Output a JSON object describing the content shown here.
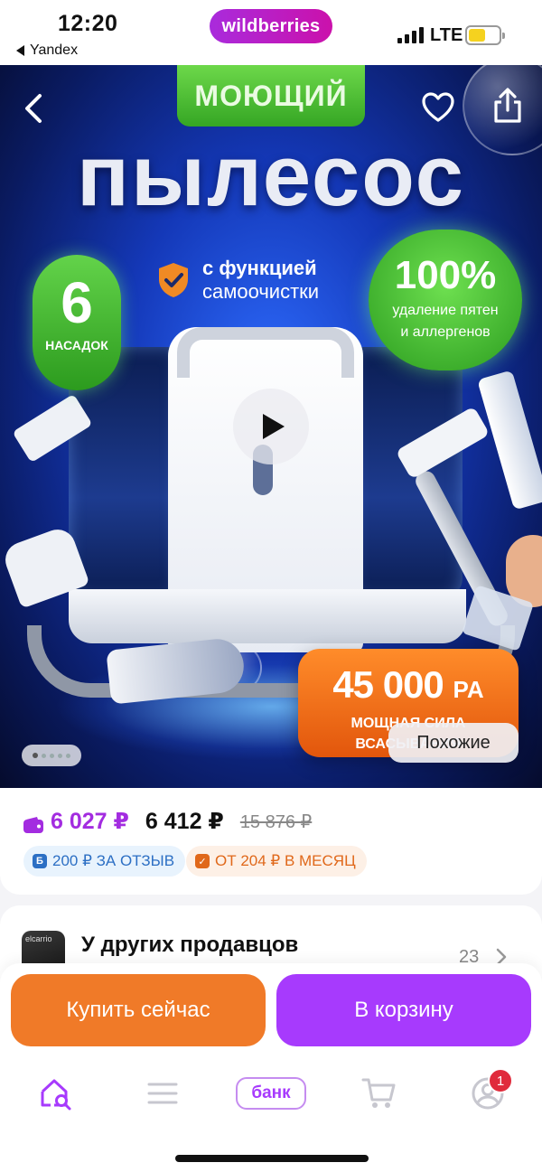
{
  "status_bar": {
    "time": "12:20",
    "back_app": "Yandex",
    "brand": "wildberries",
    "network": "LTE"
  },
  "hero": {
    "tag": "МОЮЩИЙ",
    "title": "пылесос",
    "badge_left_number": "6",
    "badge_left_caption": "НАСАДОК",
    "feature_line1": "с функцией",
    "feature_line2": "самоочистки",
    "badge_right_number": "100%",
    "badge_right_caption_line1": "удаление пятен",
    "badge_right_caption_line2": "и аллергенов",
    "power_number": "45 000",
    "power_unit": "PA",
    "power_caption_line1": "МОЩНАЯ СИЛА",
    "power_caption_line2": "ВСАСЫВАНИЯ",
    "similar_label": "Похожие",
    "slide_count": 5,
    "active_slide": 1
  },
  "price": {
    "wallet_price": "6 027 ₽",
    "price": "6 412 ₽",
    "old_price": "15 876 ₽",
    "chip_review_icon": "Б",
    "chip_review": "200 ₽ ЗА ОТЗЫВ",
    "chip_month_icon": "✓",
    "chip_month": "ОТ 204 ₽ В МЕСЯЦ"
  },
  "sellers": {
    "title": "У других продавцов",
    "count": "23",
    "thumb_text": "elcarrio"
  },
  "actions": {
    "buy_now": "Купить сейчас",
    "add_to_cart": "В корзину"
  },
  "tabbar": {
    "bank": "банк",
    "notifications": "1"
  },
  "colors": {
    "brand_purple": "#a73afd",
    "buy_orange": "#f07a28",
    "wallet_purple": "#a32ce0",
    "badge_green": "#35a624",
    "power_orange": "#e2560c"
  }
}
